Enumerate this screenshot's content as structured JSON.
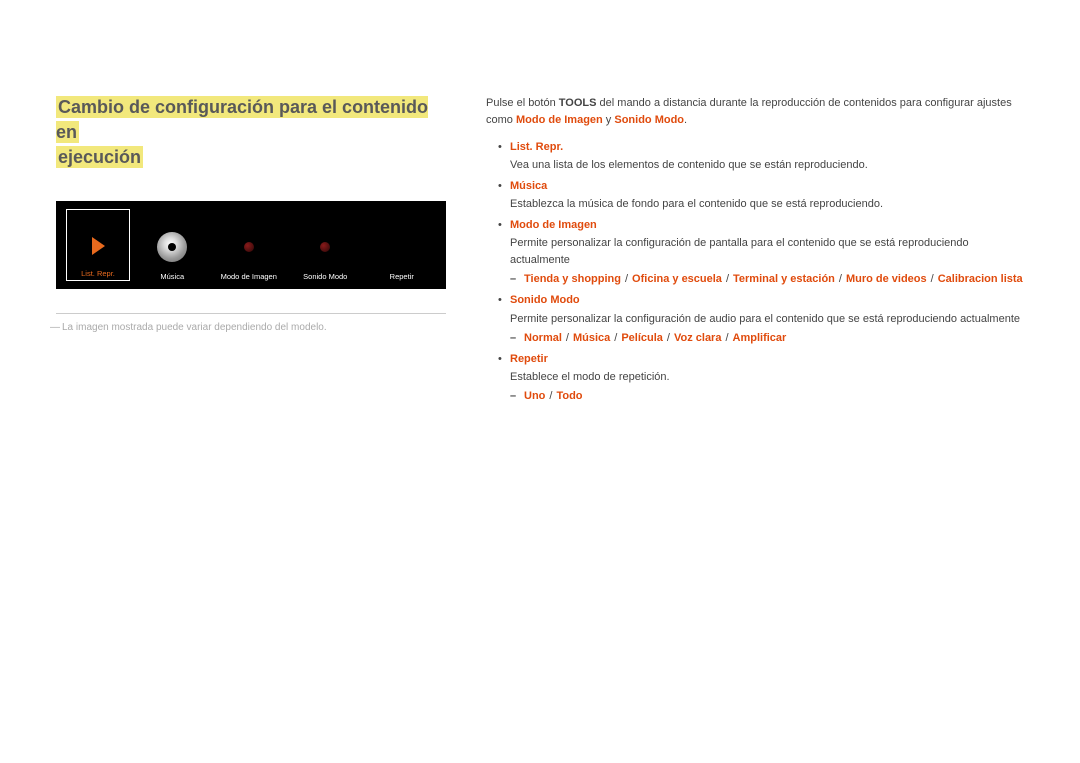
{
  "title_line1": "Cambio de configuración para el contenido en",
  "title_line2": "ejecución",
  "toolbar": {
    "items": [
      {
        "label": "List. Repr."
      },
      {
        "label": "Música"
      },
      {
        "label": "Modo de Imagen"
      },
      {
        "label": "Sonido Modo"
      },
      {
        "label": "Repetir"
      }
    ]
  },
  "footnote": "La imagen mostrada puede variar dependiendo del modelo.",
  "intro": {
    "pre": "Pulse el botón ",
    "tools": "TOOLS",
    "mid": " del mando a distancia durante la reproducción de contenidos para configurar ajustes como ",
    "mode1": "Modo de Imagen",
    "and": " y ",
    "mode2": "Sonido Modo",
    "end": ". "
  },
  "items": [
    {
      "title": "List. Repr.",
      "desc": "Vea una lista de los elementos de contenido que se están reproduciendo."
    },
    {
      "title": "Música",
      "desc": "Establezca la música de fondo para el contenido que se está reproduciendo."
    },
    {
      "title": "Modo de Imagen",
      "desc": "Permite personalizar la configuración de pantalla para el contenido que se está reproduciendo actualmente",
      "options": [
        "Tienda y shopping",
        "Oficina y escuela",
        "Terminal y estación",
        "Muro de videos",
        "Calibracion lista"
      ]
    },
    {
      "title": "Sonido Modo",
      "desc": "Permite personalizar la configuración de audio para el contenido que se está reproduciendo actualmente",
      "options": [
        "Normal",
        "Música",
        "Película",
        "Voz clara",
        "Amplificar"
      ]
    },
    {
      "title": "Repetir",
      "desc": "Establece el modo de repetición.",
      "options": [
        "Uno",
        "Todo"
      ]
    }
  ]
}
